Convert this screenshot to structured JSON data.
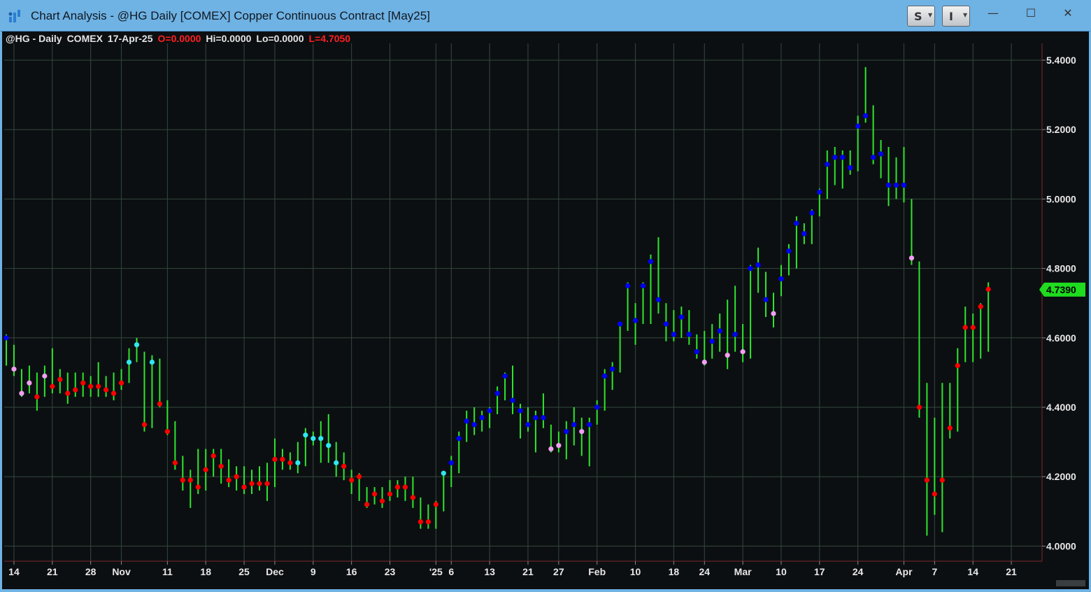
{
  "window": {
    "title": "Chart Analysis - @HG Daily [COMEX] Copper Continuous Contract [May25]",
    "buttons": [
      {
        "label": "S",
        "icon": "chevron-down-icon"
      },
      {
        "label": "I",
        "icon": "chevron-down-icon"
      }
    ],
    "controls": {
      "minimize": "—",
      "maximize": "☐",
      "close": "✕"
    }
  },
  "info": {
    "symbol": "@HG - Daily",
    "exchange": "COMEX",
    "date": "17-Apr-25",
    "open": "O=0.0000",
    "high": "Hi=0.0000",
    "low": "Lo=0.0000",
    "last": "L=4.7050"
  },
  "colors": {
    "background": "#0c0f12",
    "grid": "#34483d",
    "bar": "#2ee62e",
    "up": "#0000ff",
    "down": "#ff0000",
    "up_light": "#2ee8f0",
    "down_light": "#f0a0f0",
    "last_price_tag": "#1fdc1f"
  },
  "chart_data": {
    "type": "ohlc",
    "y_axis_labels": [
      "5.4000",
      "5.2000",
      "5.0000",
      "4.8000",
      "4.6000",
      "4.4000",
      "4.2000",
      "4.0000"
    ],
    "y_axis_values": [
      5.4,
      5.2,
      5.0,
      4.8,
      4.6,
      4.4,
      4.2,
      4.0
    ],
    "ylim": [
      3.95,
      5.47
    ],
    "last_price": "4.7390",
    "last_value": 4.739,
    "x_tick_labels": [
      "14",
      "21",
      "28",
      "Nov",
      "11",
      "18",
      "25",
      "Dec",
      "9",
      "16",
      "23",
      "'25",
      "6",
      "13",
      "21",
      "27",
      "Feb",
      "10",
      "18",
      "24",
      "Mar",
      "10",
      "17",
      "24",
      "Apr",
      "7",
      "14",
      "21"
    ],
    "x_tick_bar_index": [
      1,
      6,
      11,
      15,
      21,
      26,
      31,
      35,
      40,
      45,
      50,
      56,
      58,
      63,
      68,
      72,
      77,
      82,
      87,
      91,
      96,
      101,
      106,
      111,
      117,
      121,
      126,
      131
    ],
    "marker_codes": "b = blue, r = red, c = cyan, p = pink",
    "bars": [
      {
        "h": 4.61,
        "l": 4.52,
        "c": 4.6,
        "m": "b"
      },
      {
        "h": 4.58,
        "l": 4.49,
        "c": 4.51,
        "m": "p"
      },
      {
        "h": 4.51,
        "l": 4.43,
        "c": 4.44,
        "m": "p"
      },
      {
        "h": 4.52,
        "l": 4.44,
        "c": 4.47,
        "m": "p"
      },
      {
        "h": 4.5,
        "l": 4.39,
        "c": 4.43,
        "m": "r"
      },
      {
        "h": 4.52,
        "l": 4.43,
        "c": 4.49,
        "m": "p"
      },
      {
        "h": 4.57,
        "l": 4.44,
        "c": 4.46,
        "m": "r"
      },
      {
        "h": 4.51,
        "l": 4.44,
        "c": 4.48,
        "m": "r"
      },
      {
        "h": 4.5,
        "l": 4.41,
        "c": 4.44,
        "m": "r"
      },
      {
        "h": 4.5,
        "l": 4.43,
        "c": 4.45,
        "m": "r"
      },
      {
        "h": 4.5,
        "l": 4.43,
        "c": 4.47,
        "m": "r"
      },
      {
        "h": 4.49,
        "l": 4.43,
        "c": 4.46,
        "m": "r"
      },
      {
        "h": 4.53,
        "l": 4.43,
        "c": 4.46,
        "m": "r"
      },
      {
        "h": 4.49,
        "l": 4.43,
        "c": 4.45,
        "m": "r"
      },
      {
        "h": 4.5,
        "l": 4.42,
        "c": 4.44,
        "m": "r"
      },
      {
        "h": 4.51,
        "l": 4.45,
        "c": 4.47,
        "m": "r"
      },
      {
        "h": 4.57,
        "l": 4.47,
        "c": 4.53,
        "m": "c"
      },
      {
        "h": 4.6,
        "l": 4.53,
        "c": 4.58,
        "m": "c"
      },
      {
        "h": 4.56,
        "l": 4.33,
        "c": 4.35,
        "m": "r"
      },
      {
        "h": 4.55,
        "l": 4.34,
        "c": 4.53,
        "m": "c"
      },
      {
        "h": 4.54,
        "l": 4.4,
        "c": 4.41,
        "m": "r"
      },
      {
        "h": 4.42,
        "l": 4.32,
        "c": 4.33,
        "m": "r"
      },
      {
        "h": 4.36,
        "l": 4.22,
        "c": 4.24,
        "m": "r"
      },
      {
        "h": 4.26,
        "l": 4.16,
        "c": 4.19,
        "m": "r"
      },
      {
        "h": 4.22,
        "l": 4.11,
        "c": 4.19,
        "m": "r"
      },
      {
        "h": 4.28,
        "l": 4.15,
        "c": 4.17,
        "m": "r"
      },
      {
        "h": 4.28,
        "l": 4.16,
        "c": 4.22,
        "m": "r"
      },
      {
        "h": 4.28,
        "l": 4.2,
        "c": 4.26,
        "m": "r"
      },
      {
        "h": 4.28,
        "l": 4.18,
        "c": 4.23,
        "m": "r"
      },
      {
        "h": 4.25,
        "l": 4.17,
        "c": 4.19,
        "m": "r"
      },
      {
        "h": 4.23,
        "l": 4.16,
        "c": 4.2,
        "m": "r"
      },
      {
        "h": 4.23,
        "l": 4.15,
        "c": 4.17,
        "m": "r"
      },
      {
        "h": 4.22,
        "l": 4.15,
        "c": 4.18,
        "m": "r"
      },
      {
        "h": 4.23,
        "l": 4.16,
        "c": 4.18,
        "m": "r"
      },
      {
        "h": 4.24,
        "l": 4.13,
        "c": 4.18,
        "m": "r"
      },
      {
        "h": 4.31,
        "l": 4.17,
        "c": 4.25,
        "m": "r"
      },
      {
        "h": 4.28,
        "l": 4.22,
        "c": 4.25,
        "m": "r"
      },
      {
        "h": 4.27,
        "l": 4.22,
        "c": 4.24,
        "m": "r"
      },
      {
        "h": 4.3,
        "l": 4.21,
        "c": 4.24,
        "m": "c"
      },
      {
        "h": 4.34,
        "l": 4.23,
        "c": 4.32,
        "m": "c"
      },
      {
        "h": 4.33,
        "l": 4.29,
        "c": 4.31,
        "m": "c"
      },
      {
        "h": 4.36,
        "l": 4.24,
        "c": 4.31,
        "m": "c"
      },
      {
        "h": 4.38,
        "l": 4.24,
        "c": 4.29,
        "m": "c"
      },
      {
        "h": 4.3,
        "l": 4.2,
        "c": 4.24,
        "m": "c"
      },
      {
        "h": 4.27,
        "l": 4.19,
        "c": 4.23,
        "m": "r"
      },
      {
        "h": 4.22,
        "l": 4.15,
        "c": 4.19,
        "m": "r"
      },
      {
        "h": 4.21,
        "l": 4.13,
        "c": 4.2,
        "m": "r"
      },
      {
        "h": 4.17,
        "l": 4.11,
        "c": 4.12,
        "m": "r"
      },
      {
        "h": 4.17,
        "l": 4.12,
        "c": 4.15,
        "m": "r"
      },
      {
        "h": 4.17,
        "l": 4.11,
        "c": 4.13,
        "m": "r"
      },
      {
        "h": 4.19,
        "l": 4.13,
        "c": 4.15,
        "m": "r"
      },
      {
        "h": 4.19,
        "l": 4.14,
        "c": 4.17,
        "m": "r"
      },
      {
        "h": 4.2,
        "l": 4.13,
        "c": 4.17,
        "m": "r"
      },
      {
        "h": 4.2,
        "l": 4.11,
        "c": 4.14,
        "m": "r"
      },
      {
        "h": 4.14,
        "l": 4.05,
        "c": 4.07,
        "m": "r"
      },
      {
        "h": 4.12,
        "l": 4.05,
        "c": 4.07,
        "m": "r"
      },
      {
        "h": 4.13,
        "l": 4.05,
        "c": 4.12,
        "m": "r"
      },
      {
        "h": 4.21,
        "l": 4.1,
        "c": 4.21,
        "m": "c"
      },
      {
        "h": 4.26,
        "l": 4.17,
        "c": 4.24,
        "m": "b"
      },
      {
        "h": 4.33,
        "l": 4.21,
        "c": 4.31,
        "m": "b"
      },
      {
        "h": 4.39,
        "l": 4.3,
        "c": 4.36,
        "m": "b"
      },
      {
        "h": 4.4,
        "l": 4.32,
        "c": 4.35,
        "m": "b"
      },
      {
        "h": 4.39,
        "l": 4.33,
        "c": 4.37,
        "m": "b"
      },
      {
        "h": 4.4,
        "l": 4.34,
        "c": 4.39,
        "m": "b"
      },
      {
        "h": 4.46,
        "l": 4.38,
        "c": 4.44,
        "m": "b"
      },
      {
        "h": 4.5,
        "l": 4.42,
        "c": 4.49,
        "m": "b"
      },
      {
        "h": 4.52,
        "l": 4.38,
        "c": 4.42,
        "m": "b"
      },
      {
        "h": 4.41,
        "l": 4.31,
        "c": 4.39,
        "m": "b"
      },
      {
        "h": 4.4,
        "l": 4.33,
        "c": 4.35,
        "m": "b"
      },
      {
        "h": 4.39,
        "l": 4.27,
        "c": 4.37,
        "m": "b"
      },
      {
        "h": 4.44,
        "l": 4.34,
        "c": 4.37,
        "m": "b"
      },
      {
        "h": 4.35,
        "l": 4.27,
        "c": 4.28,
        "m": "p"
      },
      {
        "h": 4.33,
        "l": 4.27,
        "c": 4.29,
        "m": "p"
      },
      {
        "h": 4.36,
        "l": 4.25,
        "c": 4.33,
        "m": "b"
      },
      {
        "h": 4.4,
        "l": 4.29,
        "c": 4.35,
        "m": "b"
      },
      {
        "h": 4.37,
        "l": 4.26,
        "c": 4.33,
        "m": "p"
      },
      {
        "h": 4.37,
        "l": 4.23,
        "c": 4.35,
        "m": "b"
      },
      {
        "h": 4.42,
        "l": 4.35,
        "c": 4.4,
        "m": "b"
      },
      {
        "h": 4.51,
        "l": 4.39,
        "c": 4.49,
        "m": "b"
      },
      {
        "h": 4.53,
        "l": 4.45,
        "c": 4.51,
        "m": "b"
      },
      {
        "h": 4.64,
        "l": 4.5,
        "c": 4.64,
        "m": "b"
      },
      {
        "h": 4.76,
        "l": 4.62,
        "c": 4.75,
        "m": "b"
      },
      {
        "h": 4.7,
        "l": 4.58,
        "c": 4.65,
        "m": "b"
      },
      {
        "h": 4.76,
        "l": 4.64,
        "c": 4.75,
        "m": "b"
      },
      {
        "h": 4.84,
        "l": 4.64,
        "c": 4.82,
        "m": "b"
      },
      {
        "h": 4.89,
        "l": 4.67,
        "c": 4.71,
        "m": "b"
      },
      {
        "h": 4.7,
        "l": 4.59,
        "c": 4.64,
        "m": "b"
      },
      {
        "h": 4.68,
        "l": 4.59,
        "c": 4.61,
        "m": "b"
      },
      {
        "h": 4.69,
        "l": 4.6,
        "c": 4.66,
        "m": "b"
      },
      {
        "h": 4.68,
        "l": 4.58,
        "c": 4.61,
        "m": "b"
      },
      {
        "h": 4.61,
        "l": 4.54,
        "c": 4.56,
        "m": "b"
      },
      {
        "h": 4.62,
        "l": 4.52,
        "c": 4.53,
        "m": "p"
      },
      {
        "h": 4.64,
        "l": 4.54,
        "c": 4.59,
        "m": "b"
      },
      {
        "h": 4.67,
        "l": 4.56,
        "c": 4.62,
        "m": "b"
      },
      {
        "h": 4.71,
        "l": 4.51,
        "c": 4.55,
        "m": "p"
      },
      {
        "h": 4.75,
        "l": 4.56,
        "c": 4.61,
        "m": "b"
      },
      {
        "h": 4.64,
        "l": 4.53,
        "c": 4.56,
        "m": "p"
      },
      {
        "h": 4.81,
        "l": 4.54,
        "c": 4.8,
        "m": "b"
      },
      {
        "h": 4.86,
        "l": 4.73,
        "c": 4.81,
        "m": "b"
      },
      {
        "h": 4.79,
        "l": 4.66,
        "c": 4.71,
        "m": "b"
      },
      {
        "h": 4.73,
        "l": 4.63,
        "c": 4.67,
        "m": "p"
      },
      {
        "h": 4.81,
        "l": 4.72,
        "c": 4.77,
        "m": "b"
      },
      {
        "h": 4.87,
        "l": 4.78,
        "c": 4.85,
        "m": "b"
      },
      {
        "h": 4.95,
        "l": 4.8,
        "c": 4.93,
        "m": "b"
      },
      {
        "h": 4.93,
        "l": 4.87,
        "c": 4.9,
        "m": "b"
      },
      {
        "h": 4.97,
        "l": 4.87,
        "c": 4.96,
        "m": "b"
      },
      {
        "h": 5.03,
        "l": 4.95,
        "c": 5.02,
        "m": "b"
      },
      {
        "h": 5.14,
        "l": 5.0,
        "c": 5.1,
        "m": "b"
      },
      {
        "h": 5.15,
        "l": 5.04,
        "c": 5.12,
        "m": "b"
      },
      {
        "h": 5.14,
        "l": 5.03,
        "c": 5.12,
        "m": "b"
      },
      {
        "h": 5.14,
        "l": 5.07,
        "c": 5.09,
        "m": "b"
      },
      {
        "h": 5.24,
        "l": 5.08,
        "c": 5.21,
        "m": "b"
      },
      {
        "h": 5.38,
        "l": 5.22,
        "c": 5.24,
        "m": "b"
      },
      {
        "h": 5.27,
        "l": 5.1,
        "c": 5.12,
        "m": "b"
      },
      {
        "h": 5.17,
        "l": 5.06,
        "c": 5.13,
        "m": "b"
      },
      {
        "h": 5.15,
        "l": 4.98,
        "c": 5.04,
        "m": "b"
      },
      {
        "h": 5.12,
        "l": 5.0,
        "c": 5.04,
        "m": "b"
      },
      {
        "h": 5.15,
        "l": 4.99,
        "c": 5.04,
        "m": "b"
      },
      {
        "h": 5.0,
        "l": 4.81,
        "c": 4.83,
        "m": "p"
      },
      {
        "h": 4.82,
        "l": 4.37,
        "c": 4.4,
        "m": "r"
      },
      {
        "h": 4.47,
        "l": 4.03,
        "c": 4.19,
        "m": "r"
      },
      {
        "h": 4.37,
        "l": 4.09,
        "c": 4.15,
        "m": "r"
      },
      {
        "h": 4.47,
        "l": 4.04,
        "c": 4.19,
        "m": "r"
      },
      {
        "h": 4.47,
        "l": 4.31,
        "c": 4.34,
        "m": "r"
      },
      {
        "h": 4.57,
        "l": 4.33,
        "c": 4.52,
        "m": "r"
      },
      {
        "h": 4.69,
        "l": 4.53,
        "c": 4.63,
        "m": "r"
      },
      {
        "h": 4.67,
        "l": 4.53,
        "c": 4.63,
        "m": "r"
      },
      {
        "h": 4.7,
        "l": 4.54,
        "c": 4.69,
        "m": "r"
      },
      {
        "h": 4.76,
        "l": 4.56,
        "c": 4.74,
        "m": "r"
      }
    ]
  }
}
